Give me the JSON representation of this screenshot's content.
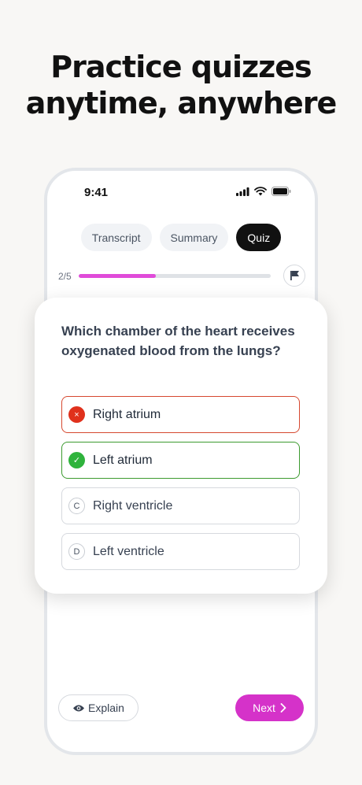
{
  "headline": {
    "line1": "Practice quizzes",
    "line2": "anytime, anywhere"
  },
  "status_bar": {
    "time": "9:41",
    "icons": [
      "signal-icon",
      "wifi-icon",
      "battery-icon"
    ]
  },
  "tabs": [
    {
      "label": "Transcript",
      "active": false
    },
    {
      "label": "Summary",
      "active": false
    },
    {
      "label": "Quiz",
      "active": true
    }
  ],
  "progress": {
    "label": "2/5",
    "fraction": 0.4,
    "color": "#e04bd9"
  },
  "quiz": {
    "question": "Which chamber of the heart receives oxygenated blood from the lungs?",
    "options": [
      {
        "badge": "×",
        "label": "Right atrium",
        "state": "wrong"
      },
      {
        "badge": "✓",
        "label": "Left atrium",
        "state": "correct"
      },
      {
        "badge": "C",
        "label": "Right ventricle",
        "state": "default"
      },
      {
        "badge": "D",
        "label": "Left ventricle",
        "state": "default"
      }
    ]
  },
  "footer": {
    "explain_label": "Explain",
    "next_label": "Next"
  },
  "colors": {
    "accent": "#d532c9",
    "wrong": "#e0311c",
    "correct": "#2fb33c"
  }
}
